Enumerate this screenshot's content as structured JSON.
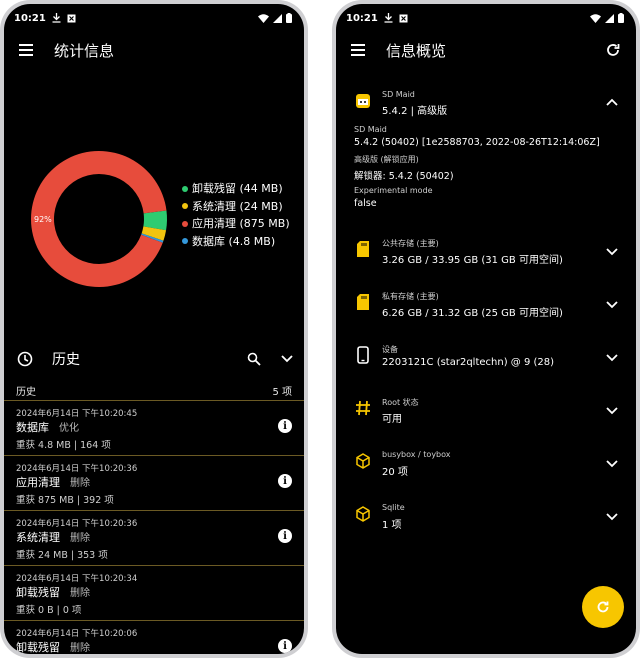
{
  "left": {
    "status_time": "10:21",
    "title": "统计信息",
    "chart_data": {
      "type": "pie",
      "slice_label": "92%",
      "slices": [
        {
          "name": "卸载残留 (44 MB)",
          "value": 44,
          "color": "#2ecc71"
        },
        {
          "name": "系统清理 (24 MB)",
          "value": 24,
          "color": "#f1c40f"
        },
        {
          "name": "应用清理 (875 MB)",
          "value": 875,
          "color": "#e74c3c"
        },
        {
          "name": "数据库 (4.8 MB)",
          "value": 4.8,
          "color": "#3498db"
        }
      ]
    },
    "history_title": "历史",
    "history_label": "历史",
    "history_count": "5 项",
    "items": [
      {
        "ts": "2024年6月14日 下午10:20:45",
        "name": "数据库",
        "action": "优化",
        "detail": "重获 4.8 MB | 164 项"
      },
      {
        "ts": "2024年6月14日 下午10:20:36",
        "name": "应用清理",
        "action": "删除",
        "detail": "重获 875 MB | 392 项"
      },
      {
        "ts": "2024年6月14日 下午10:20:36",
        "name": "系统清理",
        "action": "删除",
        "detail": "重获 24 MB | 353 项"
      },
      {
        "ts": "2024年6月14日 下午10:20:34",
        "name": "卸载残留",
        "action": "删除",
        "detail": "重获 0 B | 0 项"
      },
      {
        "ts": "2024年6月14日 下午10:20:06",
        "name": "卸载残留",
        "action": "删除",
        "detail": ""
      }
    ]
  },
  "right": {
    "status_time": "10:21",
    "title": "信息概览",
    "sdmaid": {
      "title": "SD Maid",
      "value": "5.4.2 | 高级版",
      "details": [
        {
          "k": "SD Maid",
          "v": "5.4.2 (50402) [1e2588703, 2022-08-26T12:14:06Z]"
        },
        {
          "k": "高级版 (解锁应用)",
          "v": "解锁器: 5.4.2 (50402)"
        },
        {
          "k": "Experimental mode",
          "v": "false"
        }
      ]
    },
    "sections": [
      {
        "title": "公共存储 (主要)",
        "value": "3.26 GB / 33.95 GB (31 GB 可用空间)",
        "icon": "sdcard-icon"
      },
      {
        "title": "私有存储 (主要)",
        "value": "6.26 GB / 31.32 GB (25 GB 可用空间)",
        "icon": "sdcard-icon"
      },
      {
        "title": "设备",
        "value": "2203121C (star2qltechn) @ 9 (28)",
        "icon": "phone-icon"
      },
      {
        "title": "Root 状态",
        "value": "可用",
        "icon": "hash-icon"
      },
      {
        "title": "busybox / toybox",
        "value": "20 项",
        "icon": "box-icon"
      },
      {
        "title": "Sqlite",
        "value": "1 项",
        "icon": "box-icon"
      }
    ]
  },
  "colors": {
    "accent": "#f7c600",
    "background": "#000000",
    "divider": "#6b5a24"
  }
}
